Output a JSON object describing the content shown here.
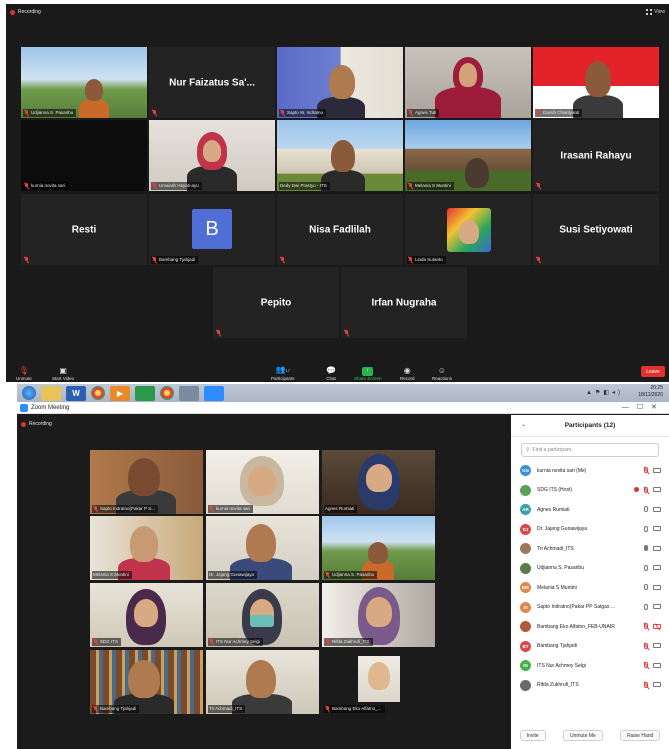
{
  "meeting1": {
    "recording_label": "Recording",
    "view_label": "View",
    "tiles": [
      {
        "id": "udjianna",
        "label": "Udjianna S. Pasaribu",
        "type": "video",
        "muted": true
      },
      {
        "id": "nurfaizatus",
        "name": "Nur Faizatus Sa'...",
        "type": "name",
        "muted": true
      },
      {
        "id": "saptow",
        "label": "Sapto W. Indratno",
        "type": "video",
        "muted": true
      },
      {
        "id": "agnes",
        "label": "Agnes Tuti",
        "type": "video",
        "muted": true
      },
      {
        "id": "darsih",
        "label": "Darsih Chakilyanti",
        "type": "video",
        "muted": true
      },
      {
        "id": "kurnia",
        "label": "kurnia novita sari",
        "type": "video",
        "muted": true
      },
      {
        "id": "umairah",
        "label": "Umairah Hayati-ayu",
        "type": "video",
        "muted": true
      },
      {
        "id": "dedy",
        "label": "Dedy Dwi Prastyo - ITS",
        "type": "video",
        "active": true
      },
      {
        "id": "melania",
        "label": "Melania S Muntini",
        "type": "video",
        "muted": true
      },
      {
        "id": "irasani",
        "name": "Irasani Rahayu",
        "type": "name",
        "muted": true
      },
      {
        "id": "resti",
        "name": "Resti",
        "type": "name",
        "muted": true
      },
      {
        "id": "bambang",
        "label": "Bambang Tjahjadi",
        "type": "avatar",
        "avatar_letter": "B",
        "muted": true
      },
      {
        "id": "nisa",
        "name": "Nisa Fadlilah",
        "type": "name",
        "muted": true
      },
      {
        "id": "linda",
        "label": "Linda Sutanto",
        "type": "video",
        "muted": true
      },
      {
        "id": "susi",
        "name": "Susi Setiyowati",
        "type": "name",
        "muted": true
      },
      {
        "id": "pepito",
        "name": "Pepito",
        "type": "name",
        "muted": true
      },
      {
        "id": "irfan",
        "name": "Irfan Nugraha",
        "type": "name",
        "muted": true
      }
    ],
    "toolbar": {
      "unmute": "Unmute",
      "start_video": "Start Video",
      "participants": "Participants",
      "participants_count": "17",
      "chat": "Chat",
      "share_screen": "Share Screen",
      "record": "Record",
      "reactions": "Reactions",
      "leave": "Leave"
    }
  },
  "meeting2": {
    "window_title": "Zoom Meeting",
    "recording_label": "Recording",
    "clock": {
      "time": "20:25",
      "date": "18/11/2020"
    },
    "tiles": [
      {
        "label": "Sapto Indratno(Pakar P S...",
        "muted": true
      },
      {
        "label": "kurnia novita sari",
        "muted": true
      },
      {
        "label": "Agnes Rumiati",
        "muted": false
      },
      {
        "label": "Melania S Muntini",
        "muted": false
      },
      {
        "label": "Dr. Jajang Gunawijaya",
        "muted": false
      },
      {
        "label": "Udjianna S. Pasaribu",
        "muted": true
      },
      {
        "label": "SDG ITS",
        "muted": true
      },
      {
        "label": "ITS Nur Achmey Selgi",
        "muted": true
      },
      {
        "label": "Rifda Zukhrufi_ITS",
        "muted": true
      },
      {
        "label": "Bambang Tjahjadi",
        "muted": true
      },
      {
        "label": "Tri Achmadi_ITS",
        "muted": false,
        "active": true
      },
      {
        "label": "Bambang Eko Alfatno_...",
        "muted": true
      }
    ],
    "participants": {
      "title": "Participants (12)",
      "search_placeholder": "Find a participant",
      "list": [
        {
          "initials": "KN",
          "name": "kurnia novita sari (Me)",
          "color": "#3a8fd6",
          "mic": "muted",
          "cam": "on"
        },
        {
          "initials": "",
          "name": "SDG ITS (Host)",
          "color": "#5aa05a",
          "mic": "muted",
          "cam": "on",
          "recording": true
        },
        {
          "initials": "AR",
          "name": "Agnes Rumiati",
          "color": "#3aa3a3",
          "mic": "on",
          "cam": "on"
        },
        {
          "initials": "DJ",
          "name": "Dr. Jajang Gunawijaya",
          "color": "#d64a4a",
          "mic": "on",
          "cam": "on"
        },
        {
          "initials": "",
          "name": "Tri Achmadi_ITS",
          "color": "#9a7a5a",
          "mic": "talk",
          "cam": "on"
        },
        {
          "initials": "",
          "name": "Udjianna S. Pasaribu",
          "color": "#5a7a4a",
          "mic": "on",
          "cam": "on"
        },
        {
          "initials": "MS",
          "name": "Melania S Muntini",
          "color": "#e0874a",
          "mic": "on",
          "cam": "on"
        },
        {
          "initials": "SI",
          "name": "Sapto Indratno(Pakar PP Satgas ...",
          "color": "#e0874a",
          "mic": "on",
          "cam": "on"
        },
        {
          "initials": "",
          "name": "Bambang Eko Alfatno_FEB-UNAIR",
          "color": "#b05a3a",
          "mic": "muted",
          "cam": "off"
        },
        {
          "initials": "BT",
          "name": "Bambang Tjahjadi",
          "color": "#d64a4a",
          "mic": "muted",
          "cam": "on"
        },
        {
          "initials": "IN",
          "name": "ITS Nur Achmey Selgi",
          "color": "#4ab04a",
          "mic": "muted",
          "cam": "on"
        },
        {
          "initials": "",
          "name": "Rifda Zukhrufi_ITS",
          "color": "#6a6a6a",
          "mic": "muted",
          "cam": "on"
        }
      ],
      "buttons": {
        "invite": "Invite",
        "unmute_me": "Unmute Me",
        "raise_hand": "Raise Hand"
      }
    }
  }
}
